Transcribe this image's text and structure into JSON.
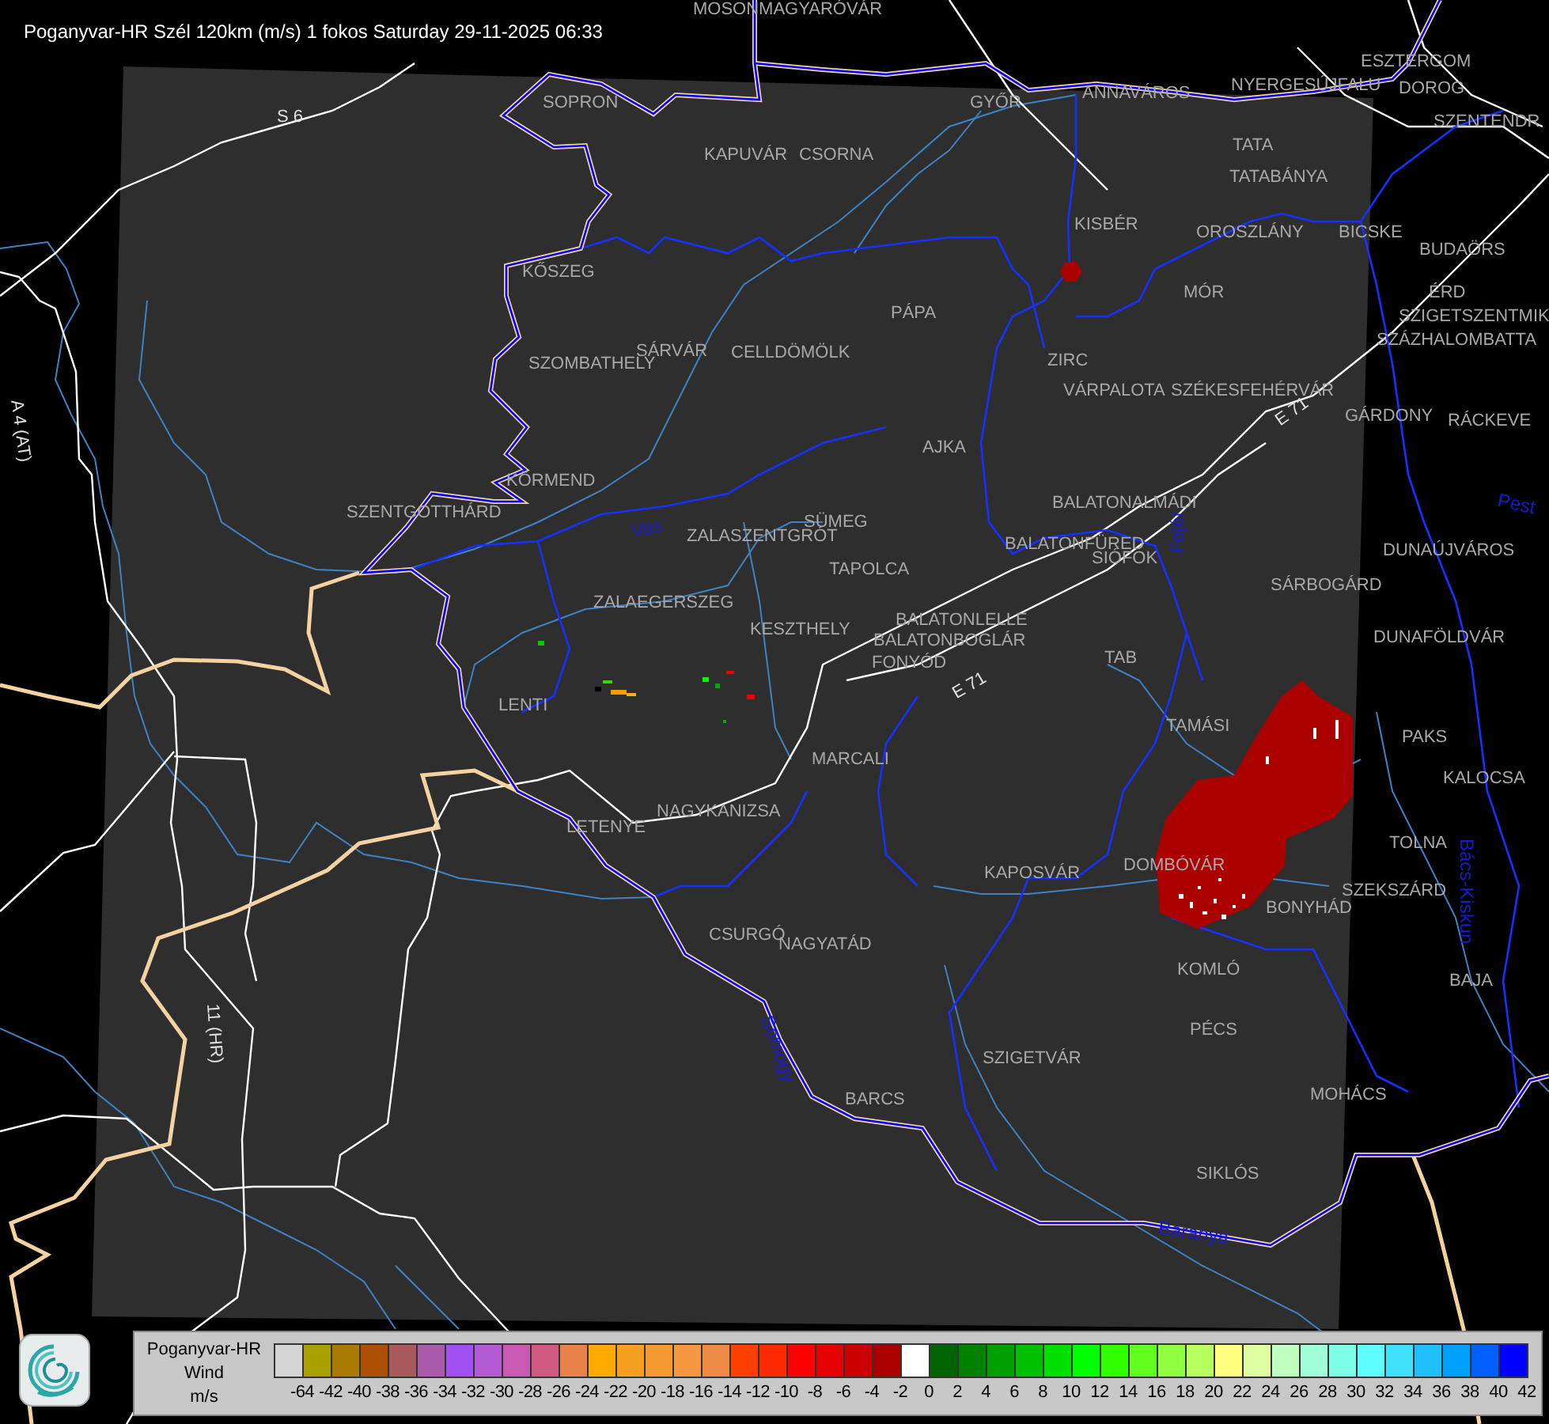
{
  "title": "Poganyvar-HR Szél 120km (m/s) 1 fokos Saturday 29-11-2025 06:33",
  "map": {
    "cities": [
      "MOSONMAGYARÓVÁR",
      "ESZTERGOM",
      "NYERGESÚJFALU",
      "DOROG",
      "SZENTENDR",
      "SOPRON",
      "GYŐR",
      "ANNAVÁROS",
      "KAPUVÁR",
      "CSORNA",
      "TATA",
      "TATABÁNYA",
      "KISBÉR",
      "OROSZLÁNY",
      "BICSKE",
      "BUDAÖRS",
      "KŐSZEG",
      "MÓR",
      "ÉRD",
      "PÁPA",
      "SZIGETSZENTMIK",
      "SZÁZHALOMBATTA",
      "SZOMBATHELY",
      "SÁRVÁR",
      "CELLDÖMÖLK",
      "ZIRC",
      "VÁRPALOTA",
      "SZÉKESFEHÉRVÁR",
      "GÁRDONY",
      "RÁCKEVE",
      "AJKA",
      "KÖRMEND",
      "SZENTGOTTHÁRD",
      "BALATONALMÁDI",
      "SÜMEG",
      "ZALASZENTGRÓT",
      "BALATONFÜRED",
      "SIÓFOK",
      "DUNAÚJVÁROS",
      "TAPOLCA",
      "ZALAEGERSZEG",
      "SÁRBOGÁRD",
      "KESZTHELY",
      "BALATONLELLE",
      "BALATONBOGLÁR",
      "FONYÓD",
      "DUNAFÖLDVÁR",
      "TAB",
      "LENTI",
      "TAMÁSI",
      "PAKS",
      "MARCALI",
      "KALOCSA",
      "NAGYKANIZSA",
      "LETENYE",
      "TOLNA",
      "KAPOSVÁR",
      "DOMBÓVÁR",
      "SZEKSZÁRD",
      "BONYHÁD",
      "CSURGÓ",
      "NAGYATÁD",
      "KOMLÓ",
      "BAJA",
      "PÉCS",
      "SZIGETVÁR",
      "MOHÁCS",
      "BARCS",
      "SIKLÓS"
    ],
    "roads": [
      "S 6",
      "A 4 (AT)",
      "11 (HR)",
      "E 71",
      "E 71"
    ],
    "counties": [
      "Vas",
      "Fejér",
      "Pest",
      "Somogy",
      "Baranya",
      "Bács-Kiskun"
    ]
  },
  "legend": {
    "title": "Poganyvar-HR",
    "quantity": "Wind",
    "unit": "m/s",
    "scale": [
      {
        "color": "#d4d4d4",
        "label": "-64"
      },
      {
        "color": "#aaa000",
        "label": "-42"
      },
      {
        "color": "#aa7a00",
        "label": "-40"
      },
      {
        "color": "#aa5000",
        "label": "-38"
      },
      {
        "color": "#aa5a5a",
        "label": "-36"
      },
      {
        "color": "#aa5aaa",
        "label": "-34"
      },
      {
        "color": "#a050f0",
        "label": "-32"
      },
      {
        "color": "#b45ad2",
        "label": "-30"
      },
      {
        "color": "#c85ab4",
        "label": "-28"
      },
      {
        "color": "#d25a82",
        "label": "-26"
      },
      {
        "color": "#e6824a",
        "label": "-24"
      },
      {
        "color": "#ffaa00",
        "label": "-22"
      },
      {
        "color": "#f5a020",
        "label": "-20"
      },
      {
        "color": "#f59a30",
        "label": "-18"
      },
      {
        "color": "#f59640",
        "label": "-16"
      },
      {
        "color": "#ec8a46",
        "label": "-14"
      },
      {
        "color": "#ff4000",
        "label": "-12"
      },
      {
        "color": "#ff2a00",
        "label": "-10"
      },
      {
        "color": "#ff0000",
        "label": "-8"
      },
      {
        "color": "#e60000",
        "label": "-6"
      },
      {
        "color": "#cc0000",
        "label": "-4"
      },
      {
        "color": "#aa0000",
        "label": "-2"
      },
      {
        "color": "#ffffff",
        "label": "0"
      },
      {
        "color": "#006400",
        "label": "2"
      },
      {
        "color": "#008200",
        "label": "4"
      },
      {
        "color": "#00a000",
        "label": "6"
      },
      {
        "color": "#00c000",
        "label": "8"
      },
      {
        "color": "#00e000",
        "label": "10"
      },
      {
        "color": "#00ff00",
        "label": "12"
      },
      {
        "color": "#30ff00",
        "label": "14"
      },
      {
        "color": "#60ff20",
        "label": "16"
      },
      {
        "color": "#90ff40",
        "label": "18"
      },
      {
        "color": "#b8ff60",
        "label": "20"
      },
      {
        "color": "#ffff80",
        "label": "22"
      },
      {
        "color": "#e0ffa0",
        "label": "24"
      },
      {
        "color": "#c0ffc0",
        "label": "26"
      },
      {
        "color": "#a0ffd8",
        "label": "28"
      },
      {
        "color": "#80ffe8",
        "label": "30"
      },
      {
        "color": "#60ffff",
        "label": "32"
      },
      {
        "color": "#40e0ff",
        "label": "34"
      },
      {
        "color": "#20c0ff",
        "label": "36"
      },
      {
        "color": "#00a0ff",
        "label": "38"
      },
      {
        "color": "#0060ff",
        "label": "40"
      },
      {
        "color": "#0000ff",
        "label": "42"
      }
    ]
  }
}
